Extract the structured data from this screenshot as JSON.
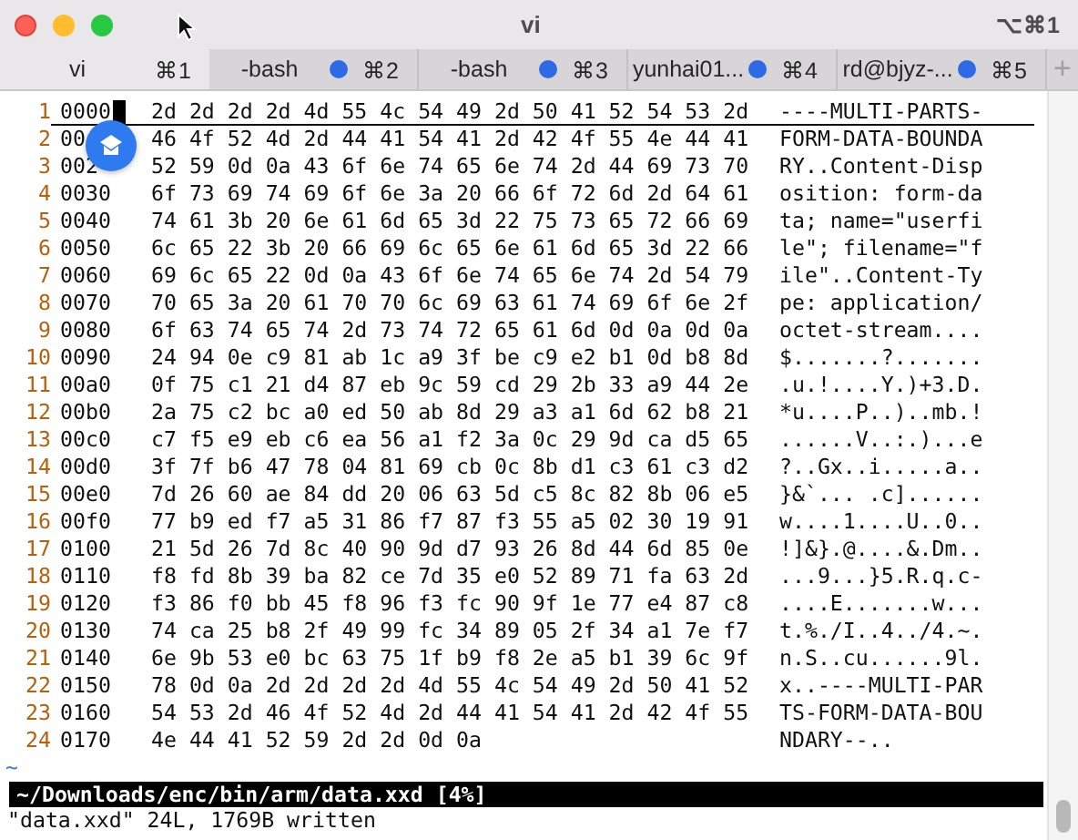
{
  "window": {
    "title": "vi",
    "shortcut": "⌥⌘1"
  },
  "tabs": [
    {
      "label": "vi",
      "shortcut": "⌘1",
      "selected": true,
      "activity": false
    },
    {
      "label": "-bash",
      "shortcut": "⌘2",
      "selected": false,
      "activity": true
    },
    {
      "label": "-bash",
      "shortcut": "⌘3",
      "selected": false,
      "activity": true
    },
    {
      "label": "yunhai01...",
      "shortcut": "⌘4",
      "selected": false,
      "activity": true
    },
    {
      "label": "rd@bjyz-...",
      "shortcut": "⌘5",
      "selected": false,
      "activity": true
    }
  ],
  "new_tab": "+",
  "editor": {
    "lines": [
      {
        "number": "1",
        "address": "0000",
        "hex": "2d 2d 2d 2d 4d 55 4c 54 49 2d 50 41 52 54 53 2d",
        "ascii": "----MULTI-PARTS-",
        "current": true
      },
      {
        "number": "2",
        "address": "00",
        "hex": "46 4f 52 4d 2d 44 41 54 41 2d 42 4f 55 4e 44 41",
        "ascii": "FORM-DATA-BOUNDA",
        "current": false
      },
      {
        "number": "3",
        "address": "002",
        "hex": "52 59 0d 0a 43 6f 6e 74 65 6e 74 2d 44 69 73 70",
        "ascii": "RY..Content-Disp",
        "current": false
      },
      {
        "number": "4",
        "address": "0030",
        "hex": "6f 73 69 74 69 6f 6e 3a 20 66 6f 72 6d 2d 64 61",
        "ascii": "osition: form-da",
        "current": false
      },
      {
        "number": "5",
        "address": "0040",
        "hex": "74 61 3b 20 6e 61 6d 65 3d 22 75 73 65 72 66 69",
        "ascii": "ta; name=\"userfi",
        "current": false
      },
      {
        "number": "6",
        "address": "0050",
        "hex": "6c 65 22 3b 20 66 69 6c 65 6e 61 6d 65 3d 22 66",
        "ascii": "le\"; filename=\"f",
        "current": false
      },
      {
        "number": "7",
        "address": "0060",
        "hex": "69 6c 65 22 0d 0a 43 6f 6e 74 65 6e 74 2d 54 79",
        "ascii": "ile\"..Content-Ty",
        "current": false
      },
      {
        "number": "8",
        "address": "0070",
        "hex": "70 65 3a 20 61 70 70 6c 69 63 61 74 69 6f 6e 2f",
        "ascii": "pe: application/",
        "current": false
      },
      {
        "number": "9",
        "address": "0080",
        "hex": "6f 63 74 65 74 2d 73 74 72 65 61 6d 0d 0a 0d 0a",
        "ascii": "octet-stream....",
        "current": false
      },
      {
        "number": "10",
        "address": "0090",
        "hex": "24 94 0e c9 81 ab 1c a9 3f be c9 e2 b1 0d b8 8d",
        "ascii": "$.......?.......",
        "current": false
      },
      {
        "number": "11",
        "address": "00a0",
        "hex": "0f 75 c1 21 d4 87 eb 9c 59 cd 29 2b 33 a9 44 2e",
        "ascii": ".u.!....Y.)+3.D.",
        "current": false
      },
      {
        "number": "12",
        "address": "00b0",
        "hex": "2a 75 c2 bc a0 ed 50 ab 8d 29 a3 a1 6d 62 b8 21",
        "ascii": "*u....P..)..mb.!",
        "current": false
      },
      {
        "number": "13",
        "address": "00c0",
        "hex": "c7 f5 e9 eb c6 ea 56 a1 f2 3a 0c 29 9d ca d5 65",
        "ascii": "......V..:.)...e",
        "current": false
      },
      {
        "number": "14",
        "address": "00d0",
        "hex": "3f 7f b6 47 78 04 81 69 cb 0c 8b d1 c3 61 c3 d2",
        "ascii": "?..Gx..i.....a..",
        "current": false
      },
      {
        "number": "15",
        "address": "00e0",
        "hex": "7d 26 60 ae 84 dd 20 06 63 5d c5 8c 82 8b 06 e5",
        "ascii": "}&`... .c]......",
        "current": false
      },
      {
        "number": "16",
        "address": "00f0",
        "hex": "77 b9 ed f7 a5 31 86 f7 87 f3 55 a5 02 30 19 91",
        "ascii": "w....1....U..0..",
        "current": false
      },
      {
        "number": "17",
        "address": "0100",
        "hex": "21 5d 26 7d 8c 40 90 9d d7 93 26 8d 44 6d 85 0e",
        "ascii": "!]&}.@....&.Dm..",
        "current": false
      },
      {
        "number": "18",
        "address": "0110",
        "hex": "f8 fd 8b 39 ba 82 ce 7d 35 e0 52 89 71 fa 63 2d",
        "ascii": "...9...}5.R.q.c-",
        "current": false
      },
      {
        "number": "19",
        "address": "0120",
        "hex": "f3 86 f0 bb 45 f8 96 f3 fc 90 9f 1e 77 e4 87 c8",
        "ascii": "....E.......w...",
        "current": false
      },
      {
        "number": "20",
        "address": "0130",
        "hex": "74 ca 25 b8 2f 49 99 fc 34 89 05 2f 34 a1 7e f7",
        "ascii": "t.%./I..4../4.~.",
        "current": false
      },
      {
        "number": "21",
        "address": "0140",
        "hex": "6e 9b 53 e0 bc 63 75 1f b9 f8 2e a5 b1 39 6c 9f",
        "ascii": "n.S..cu......9l.",
        "current": false
      },
      {
        "number": "22",
        "address": "0150",
        "hex": "78 0d 0a 2d 2d 2d 2d 4d 55 4c 54 49 2d 50 41 52",
        "ascii": "x..----MULTI-PAR",
        "current": false
      },
      {
        "number": "23",
        "address": "0160",
        "hex": "54 53 2d 46 4f 52 4d 2d 44 41 54 41 2d 42 4f 55",
        "ascii": "TS-FORM-DATA-BOU",
        "current": false
      },
      {
        "number": "24",
        "address": "0170",
        "hex": "4e 44 41 52 59 2d 2d 0d 0a",
        "ascii": "NDARY--..",
        "current": false
      }
    ],
    "empty_line_marker": "~"
  },
  "status_line": "~/Downloads/enc/bin/arm/data.xxd [4%]",
  "message": "\"data.xxd\" 24L, 1769B written"
}
